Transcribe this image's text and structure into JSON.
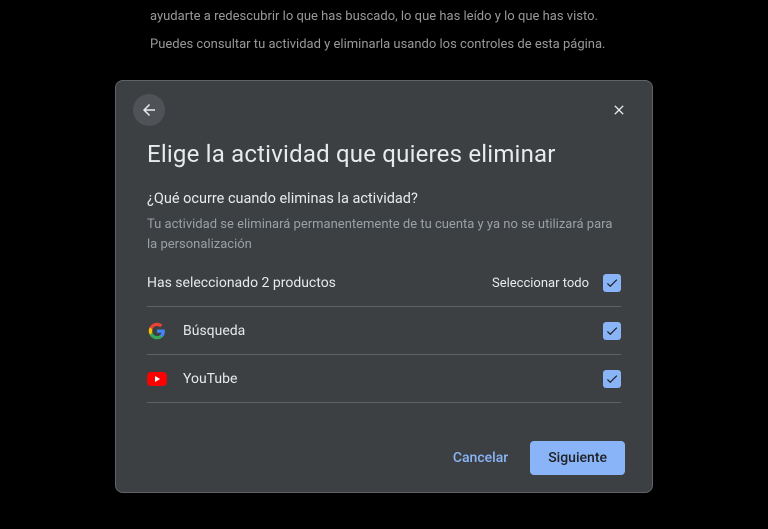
{
  "background": {
    "line1": "ayudarte a redescubrir lo que has buscado, lo que has leído y lo que has visto.",
    "line2": "Puedes consultar tu actividad y eliminarla usando los controles de esta página."
  },
  "dialog": {
    "title": "Elige la actividad que quieres eliminar",
    "subtitle": "¿Qué ocurre cuando eliminas la actividad?",
    "description": "Tu actividad se eliminará permanentemente de tu cuenta y ya no se utilizará para la personalización",
    "selection_summary": "Has seleccionado 2 productos",
    "select_all_label": "Seleccionar todo",
    "products": [
      {
        "icon": "google",
        "label": "Búsqueda",
        "checked": true
      },
      {
        "icon": "youtube",
        "label": "YouTube",
        "checked": true
      }
    ],
    "cancel_label": "Cancelar",
    "next_label": "Siguiente"
  }
}
